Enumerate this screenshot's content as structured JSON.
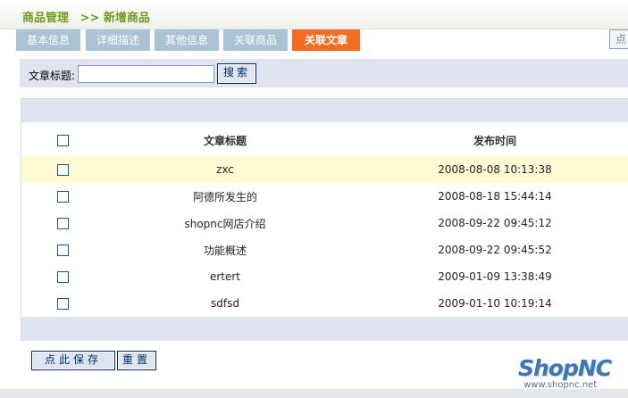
{
  "header": {
    "section": "商品管理",
    "separator": ">>",
    "page": "新增商品"
  },
  "tabs": [
    {
      "label": "基本信息",
      "active": false
    },
    {
      "label": "详细描述",
      "active": false
    },
    {
      "label": "其他信息",
      "active": false
    },
    {
      "label": "关联商品",
      "active": false
    },
    {
      "label": "关联文章",
      "active": true
    }
  ],
  "tab_edge_label": "点",
  "search": {
    "label": "文章标题:",
    "value": "",
    "placeholder": "",
    "button_label": "搜索"
  },
  "table": {
    "headers": {
      "title": "文章标题",
      "time": "发布时间"
    },
    "rows": [
      {
        "title": "zxc",
        "time": "2008-08-08 10:13:38",
        "checked": false,
        "highlighted": true
      },
      {
        "title": "阿德所发生的",
        "time": "2008-08-18 15:44:14",
        "checked": false,
        "highlighted": false
      },
      {
        "title": "shopnc网店介绍",
        "time": "2008-09-22 09:45:12",
        "checked": false,
        "highlighted": false
      },
      {
        "title": "功能概述",
        "time": "2008-09-22 09:45:52",
        "checked": false,
        "highlighted": false
      },
      {
        "title": "ertert",
        "time": "2009-01-09 13:38:49",
        "checked": false,
        "highlighted": false
      },
      {
        "title": "sdfsd",
        "time": "2009-01-10 10:19:14",
        "checked": false,
        "highlighted": false
      }
    ]
  },
  "actions": {
    "save_label": "点此保存",
    "reset_label": "重置"
  },
  "logo": {
    "name": "ShopNC",
    "url": "www.shopnc.net"
  },
  "colors": {
    "accent_green": "#6f9a1e",
    "tab_inactive": "#a9c2d4",
    "tab_active": "#f26d21",
    "bar_background": "#dfe4ef",
    "row_highlight": "#fffbd5",
    "logo_blue": "#3f76b4"
  }
}
